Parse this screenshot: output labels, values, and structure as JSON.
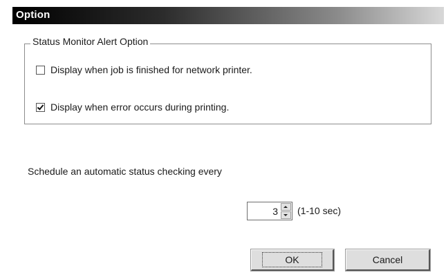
{
  "window": {
    "title": "Option"
  },
  "status_group": {
    "legend": "Status Monitor Alert Option",
    "options": [
      {
        "label": "Display when job is finished for network printer.",
        "checked": false
      },
      {
        "label": "Display when error occurs during printing.",
        "checked": true
      }
    ]
  },
  "schedule": {
    "label": "Schedule an automatic status checking every",
    "value": "3",
    "range_label": "(1-10 sec)"
  },
  "buttons": {
    "ok_label": "OK",
    "cancel_label": "Cancel"
  },
  "colors": {
    "titlebar_start": "#000000",
    "titlebar_end": "#d8d8d8",
    "button_face": "#dedede"
  }
}
